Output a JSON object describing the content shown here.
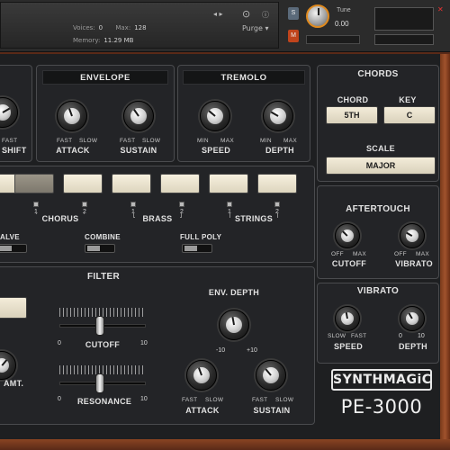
{
  "header": {
    "voices_label": "Voices:",
    "voices_value": "0",
    "max_label": "Max:",
    "max_value": "128",
    "memory_label": "Memory:",
    "memory_value": "11.29 MB",
    "purge_label": "Purge",
    "s_label": "S",
    "m_label": "M",
    "tune_label": "Tune",
    "tune_value": "0.00",
    "solo_color": "#5b6a7a",
    "mute_color": "#c0441c",
    "accent": "#e08a1e"
  },
  "section_left": {
    "knob_sub_fast": "FAST",
    "knob_label": "SHIFT"
  },
  "envelope": {
    "title": "ENVELOPE",
    "attack": {
      "label": "ATTACK",
      "min": "FAST",
      "max": "SLOW"
    },
    "sustain": {
      "label": "SUSTAIN",
      "min": "FAST",
      "max": "SLOW"
    }
  },
  "tremolo": {
    "title": "TREMOLO",
    "speed": {
      "label": "SPEED",
      "min": "MIN",
      "max": "MAX"
    },
    "depth": {
      "label": "DEPTH",
      "min": "MIN",
      "max": "MAX"
    }
  },
  "chords": {
    "title": "CHORDS",
    "chord_label": "CHORD",
    "chord_value": "5TH",
    "key_label": "KEY",
    "key_value": "C",
    "scale_label": "SCALE",
    "scale_value": "MAJOR"
  },
  "voices": {
    "groups": [
      {
        "name": "CHORUS",
        "n1": "1",
        "n2": "2"
      },
      {
        "name": "BRASS",
        "n1": "1",
        "n2": "2"
      },
      {
        "name": "STRINGS",
        "n1": "1",
        "n2": "2"
      }
    ],
    "valve_label": "ALVE",
    "combine_label": "COMBINE",
    "full_poly_label": "FULL POLY"
  },
  "aftertouch": {
    "title": "AFTERTOUCH",
    "cutoff": {
      "label": "CUTOFF",
      "min": "OFF",
      "max": "MAX"
    },
    "vibrato": {
      "label": "VIBRATO",
      "min": "OFF",
      "max": "MAX"
    }
  },
  "filter": {
    "title": "FILTER",
    "amt_label": "AMT.",
    "cutoff_label": "CUTOFF",
    "cutoff_min": "0",
    "cutoff_max": "10",
    "resonance_label": "RESONANCE",
    "resonance_min": "0",
    "resonance_max": "10",
    "env_depth_label": "ENV. DEPTH",
    "env_min": "-10",
    "env_max": "+10",
    "attack": {
      "label": "ATTACK",
      "min": "FAST",
      "max": "SLOW"
    },
    "sustain": {
      "label": "SUSTAIN",
      "min": "FAST",
      "max": "SLOW"
    }
  },
  "vibrato": {
    "title": "VIBRATO",
    "speed": {
      "label": "SPEED",
      "min": "SLOW",
      "max": "FAST"
    },
    "depth": {
      "label": "DEPTH",
      "min": "0",
      "max": "10"
    }
  },
  "brand": {
    "logo": "SYNTHMAGiC",
    "model": "PE-3000"
  }
}
